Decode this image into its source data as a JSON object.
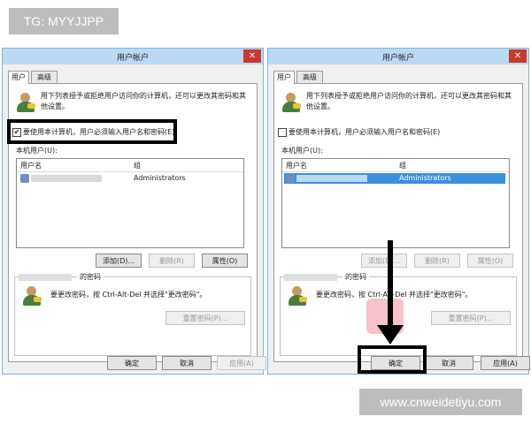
{
  "watermarks": {
    "top_left": "TG: MYYJJPP",
    "bottom_right": "www.cnweidetiyu.com"
  },
  "dialog": {
    "title": "用户帐户",
    "close_glyph": "✕",
    "tabs": [
      "用户",
      "高级"
    ],
    "description": "用下列表授予或拒绝用户访问你的计算机，还可以更改其密码和其他设置。",
    "checkbox_label": "要使用本计算机，用户必须输入用户名和密码(E)",
    "local_users_label": "本机用户(U):",
    "columns": [
      "用户名",
      "组"
    ],
    "user_row": {
      "group": "Administrators"
    },
    "buttons": {
      "add": "添加(D)...",
      "remove": "删除(R)",
      "properties": "属性(O)"
    },
    "password_group_title": "的密码",
    "password_text": "要更改密码，按 Ctrl-Alt-Del 并选择\"更改密码\"。",
    "reset_password": "重置密码(P)...",
    "ok": "确定",
    "cancel": "取消",
    "apply": "应用(A)"
  },
  "left_state": {
    "checked": true,
    "checkmark": "✔",
    "row_selected": false
  },
  "right_state": {
    "checked": false,
    "row_selected": true
  },
  "colors": {
    "titlebar": "#bcd9f4",
    "selection": "#3b8fdf",
    "close": "#c7392c",
    "highlight": "#000000"
  }
}
